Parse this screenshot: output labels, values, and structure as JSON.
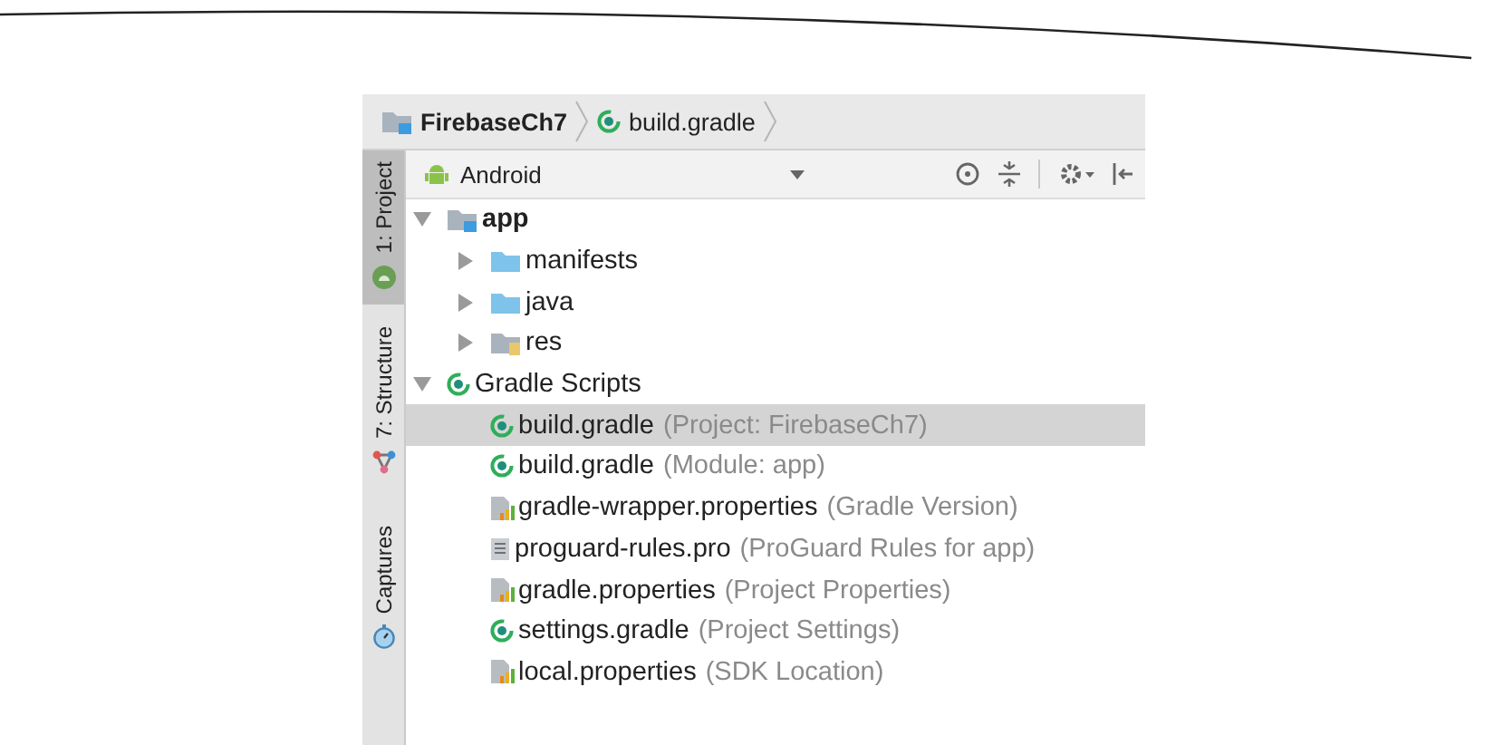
{
  "breadcrumbs": [
    {
      "label": "FirebaseCh7",
      "kind": "module"
    },
    {
      "label": "build.gradle",
      "kind": "gradle"
    }
  ],
  "side_tabs": [
    {
      "label": "1: Project",
      "kind": "android",
      "selected": true
    },
    {
      "label": "7: Structure",
      "kind": "structure",
      "selected": false
    },
    {
      "label": "Captures",
      "kind": "captures",
      "selected": false
    }
  ],
  "view_selector": {
    "label": "Android"
  },
  "tree": [
    {
      "label": "app",
      "kind": "module",
      "expanded": true,
      "selected": false,
      "children": [
        {
          "label": "manifests",
          "kind": "folder",
          "expanded": false,
          "selected": false
        },
        {
          "label": "java",
          "kind": "folder",
          "expanded": false,
          "selected": false
        },
        {
          "label": "res",
          "kind": "res",
          "expanded": false,
          "selected": false
        }
      ]
    },
    {
      "label": "Gradle Scripts",
      "kind": "gradle",
      "expanded": true,
      "selected": false,
      "children": [
        {
          "label": "build.gradle",
          "hint": "(Project: FirebaseCh7)",
          "kind": "gradle",
          "selected": true
        },
        {
          "label": "build.gradle",
          "hint": "(Module: app)",
          "kind": "gradle",
          "selected": false
        },
        {
          "label": "gradle-wrapper.properties",
          "hint": "(Gradle Version)",
          "kind": "properties",
          "selected": false
        },
        {
          "label": "proguard-rules.pro",
          "hint": "(ProGuard Rules for app)",
          "kind": "text",
          "selected": false
        },
        {
          "label": "gradle.properties",
          "hint": "(Project Properties)",
          "kind": "properties",
          "selected": false
        },
        {
          "label": "settings.gradle",
          "hint": "(Project Settings)",
          "kind": "gradle",
          "selected": false
        },
        {
          "label": "local.properties",
          "hint": "(SDK Location)",
          "kind": "properties",
          "selected": false
        }
      ]
    }
  ]
}
